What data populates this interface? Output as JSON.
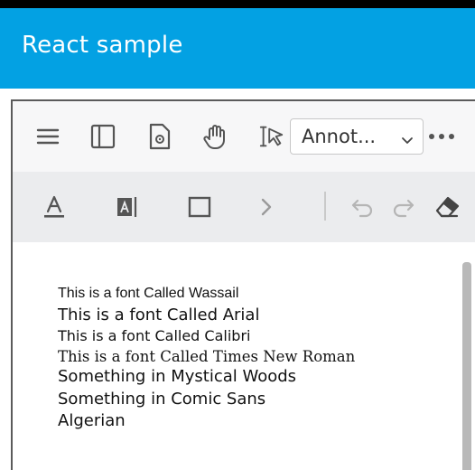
{
  "app": {
    "title": "React sample"
  },
  "toolbar": {
    "menu_icon": "hamburger-menu-icon",
    "sidebar_icon": "sidebar-toggle-icon",
    "doc_settings_icon": "document-settings-icon",
    "pan_icon": "hand-pan-icon",
    "select_icon": "text-select-cursor-icon",
    "mode_value": "Annot...",
    "more_icon": "more-horizontal-icon"
  },
  "annotation_toolbar": {
    "text_color_icon": "text-color-icon",
    "freetext_icon": "free-text-icon",
    "rectangle_icon": "rectangle-icon",
    "next_icon": "chevron-right-icon",
    "undo_icon": "undo-icon",
    "redo_icon": "redo-icon",
    "eraser_icon": "eraser-icon"
  },
  "document": {
    "lines": [
      "This is a font Called Wassail",
      "This is a font Called Arial",
      "This is a font Called Calibri",
      "This is a font Called Times New Roman",
      "Something in Mystical Woods",
      "Something in Comic Sans",
      "Algerian"
    ]
  }
}
